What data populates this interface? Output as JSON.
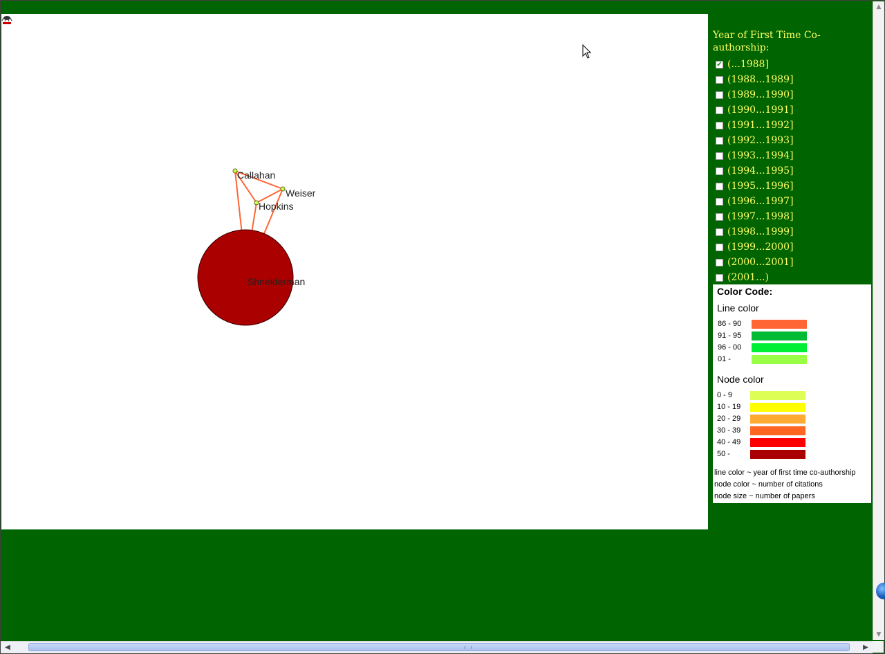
{
  "graph": {
    "nodes": [
      {
        "id": "callahan",
        "label": "Callahan"
      },
      {
        "id": "weiser",
        "label": "Weiser"
      },
      {
        "id": "hopkins",
        "label": "Hopkins"
      },
      {
        "id": "shneiderman",
        "label": "Shneiderman"
      }
    ],
    "edge_color": "#ff6633",
    "small_node_color": "#ccff66",
    "large_node_color": "#aa0000"
  },
  "sidebar": {
    "title": "Year of First Time Co-authorship:",
    "years": [
      {
        "label": "(...1988]",
        "checked": true
      },
      {
        "label": "(1988...1989]",
        "checked": false
      },
      {
        "label": "(1989...1990]",
        "checked": false
      },
      {
        "label": "(1990...1991]",
        "checked": false
      },
      {
        "label": "(1991...1992]",
        "checked": false
      },
      {
        "label": "(1992...1993]",
        "checked": false
      },
      {
        "label": "(1993...1994]",
        "checked": false
      },
      {
        "label": "(1994...1995]",
        "checked": false
      },
      {
        "label": "(1995...1996]",
        "checked": false
      },
      {
        "label": "(1996...1997]",
        "checked": false
      },
      {
        "label": "(1997...1998]",
        "checked": false
      },
      {
        "label": "(1998...1999]",
        "checked": false
      },
      {
        "label": "(1999...2000]",
        "checked": false
      },
      {
        "label": "(2000...2001]",
        "checked": false
      },
      {
        "label": "(2001...)",
        "checked": false
      }
    ]
  },
  "color_code": {
    "title": "Color Code:",
    "line_heading": "Line color",
    "line_rows": [
      {
        "range": "86 - 90",
        "color": "#ff6633"
      },
      {
        "range": "91 - 95",
        "color": "#00bb33"
      },
      {
        "range": "96 - 00",
        "color": "#00ee33"
      },
      {
        "range": "01 -",
        "color": "#99ff44"
      }
    ],
    "node_heading": "Node color",
    "node_rows": [
      {
        "range": "0 - 9",
        "color": "#ddff55"
      },
      {
        "range": "10 - 19",
        "color": "#ffff00"
      },
      {
        "range": "20 - 29",
        "color": "#ffaa33"
      },
      {
        "range": "30 - 39",
        "color": "#ff6622"
      },
      {
        "range": "40 - 49",
        "color": "#ff0000"
      },
      {
        "range": "50 -",
        "color": "#aa0000"
      }
    ],
    "notes": [
      "line color ~ year of first time co-authorship",
      "node color ~ number of citations",
      "node size ~ number of papers"
    ]
  }
}
